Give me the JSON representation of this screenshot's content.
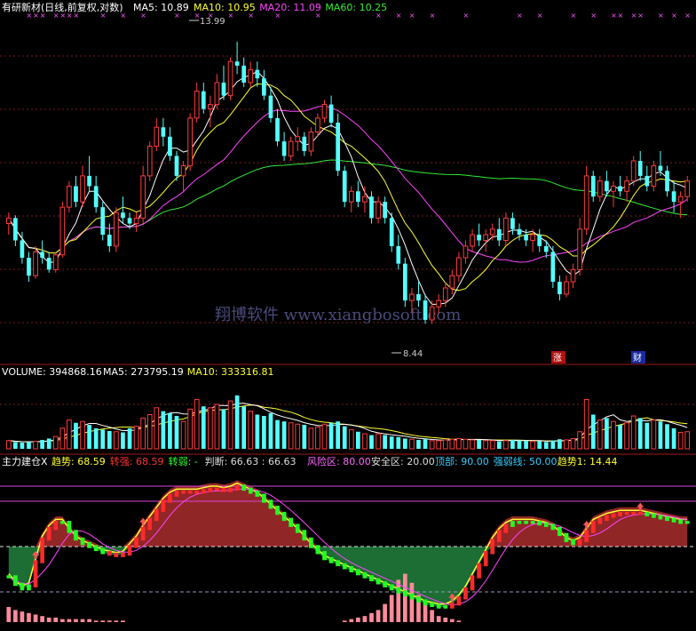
{
  "chart_data": [
    {
      "panel": "price",
      "type": "candlestick",
      "title": "有研新材(日线,前复权,对数)",
      "log_scale": true,
      "ylim": [
        8.0,
        14.6
      ],
      "legend": [
        {
          "label": "MA5: 10.89",
          "color": "#ffffff"
        },
        {
          "label": "MA10: 10.95",
          "color": "#ffff33"
        },
        {
          "label": "MA20: 11.09",
          "color": "#ff44ff"
        },
        {
          "label": "MA60: 10.25",
          "color": "#33ee33"
        }
      ],
      "annotations": {
        "high": "13.99",
        "low": "8.44"
      },
      "event_markers": [
        "涨",
        "财"
      ],
      "watermark": "翔博软件 www.xiangbosoft.com",
      "candles": [
        [
          10.1,
          10.3,
          9.9,
          10.2
        ],
        [
          10.2,
          10.25,
          9.7,
          9.8
        ],
        [
          9.8,
          9.95,
          9.4,
          9.5
        ],
        [
          9.5,
          9.6,
          9.1,
          9.2
        ],
        [
          9.2,
          9.7,
          9.15,
          9.6
        ],
        [
          9.6,
          9.8,
          9.4,
          9.5
        ],
        [
          9.5,
          9.6,
          9.25,
          9.3
        ],
        [
          9.3,
          9.6,
          9.25,
          9.55
        ],
        [
          9.55,
          10.5,
          9.5,
          10.4
        ],
        [
          10.4,
          10.9,
          10.3,
          10.8
        ],
        [
          10.8,
          11.0,
          10.4,
          10.5
        ],
        [
          10.5,
          11.2,
          10.4,
          11.0
        ],
        [
          11.0,
          11.4,
          10.7,
          10.8
        ],
        [
          10.8,
          11.0,
          10.3,
          10.4
        ],
        [
          10.4,
          10.5,
          9.8,
          9.9
        ],
        [
          9.9,
          10.1,
          9.6,
          9.7
        ],
        [
          9.7,
          10.4,
          9.6,
          10.3
        ],
        [
          10.3,
          10.6,
          10.1,
          10.2
        ],
        [
          10.2,
          10.3,
          10.0,
          10.1
        ],
        [
          10.1,
          10.3,
          9.95,
          10.2
        ],
        [
          10.2,
          11.2,
          10.1,
          11.0
        ],
        [
          11.0,
          11.7,
          10.9,
          11.6
        ],
        [
          11.6,
          12.2,
          11.5,
          12.0
        ],
        [
          12.0,
          12.2,
          11.6,
          11.8
        ],
        [
          11.8,
          12.0,
          11.3,
          11.4
        ],
        [
          11.4,
          11.5,
          10.9,
          11.0
        ],
        [
          11.0,
          11.3,
          10.7,
          11.2
        ],
        [
          11.2,
          12.3,
          11.1,
          12.2
        ],
        [
          12.2,
          13.0,
          12.1,
          12.8
        ],
        [
          12.8,
          13.0,
          12.3,
          12.4
        ],
        [
          12.4,
          12.7,
          12.0,
          12.5
        ],
        [
          12.5,
          13.2,
          12.4,
          13.0
        ],
        [
          13.0,
          13.4,
          12.6,
          12.7
        ],
        [
          12.7,
          13.6,
          12.6,
          13.5
        ],
        [
          13.5,
          13.99,
          13.2,
          13.4
        ],
        [
          13.4,
          13.6,
          12.9,
          13.0
        ],
        [
          13.0,
          13.5,
          12.9,
          13.3
        ],
        [
          13.3,
          13.5,
          12.9,
          13.1
        ],
        [
          13.1,
          13.3,
          12.6,
          12.7
        ],
        [
          12.7,
          12.9,
          12.1,
          12.2
        ],
        [
          12.2,
          12.4,
          11.6,
          11.7
        ],
        [
          11.7,
          11.9,
          11.3,
          11.4
        ],
        [
          11.4,
          11.8,
          11.3,
          11.7
        ],
        [
          11.7,
          12.0,
          11.5,
          11.8
        ],
        [
          11.8,
          11.9,
          11.4,
          11.5
        ],
        [
          11.5,
          12.0,
          11.4,
          11.9
        ],
        [
          11.9,
          12.3,
          11.8,
          12.2
        ],
        [
          12.2,
          12.6,
          12.1,
          12.5
        ],
        [
          12.5,
          12.7,
          12.0,
          12.1
        ],
        [
          12.1,
          12.3,
          11.0,
          11.1
        ],
        [
          11.1,
          11.2,
          10.4,
          10.5
        ],
        [
          10.5,
          10.8,
          10.3,
          10.7
        ],
        [
          10.7,
          10.9,
          10.4,
          10.5
        ],
        [
          10.5,
          10.8,
          10.3,
          10.6
        ],
        [
          10.6,
          10.7,
          10.1,
          10.2
        ],
        [
          10.2,
          10.6,
          10.1,
          10.5
        ],
        [
          10.5,
          10.6,
          10.1,
          10.2
        ],
        [
          10.2,
          10.3,
          9.6,
          9.7
        ],
        [
          9.7,
          9.9,
          9.3,
          9.4
        ],
        [
          9.4,
          9.5,
          8.7,
          8.8
        ],
        [
          8.8,
          9.0,
          8.6,
          8.9
        ],
        [
          8.9,
          9.1,
          8.7,
          8.8
        ],
        [
          8.8,
          8.9,
          8.44,
          8.5
        ],
        [
          8.5,
          8.8,
          8.44,
          8.7
        ],
        [
          8.7,
          8.9,
          8.6,
          8.8
        ],
        [
          8.8,
          9.1,
          8.7,
          9.0
        ],
        [
          9.0,
          9.3,
          8.9,
          9.2
        ],
        [
          9.2,
          9.6,
          9.1,
          9.5
        ],
        [
          9.5,
          9.8,
          9.4,
          9.7
        ],
        [
          9.7,
          10.0,
          9.6,
          9.9
        ],
        [
          9.9,
          10.1,
          9.7,
          9.8
        ],
        [
          9.8,
          10.0,
          9.6,
          9.9
        ],
        [
          9.9,
          10.1,
          9.8,
          10.0
        ],
        [
          10.0,
          10.2,
          9.7,
          9.8
        ],
        [
          9.8,
          10.3,
          9.7,
          10.2
        ],
        [
          10.2,
          10.3,
          9.9,
          10.0
        ],
        [
          10.0,
          10.1,
          9.8,
          9.9
        ],
        [
          9.9,
          10.0,
          9.7,
          9.8
        ],
        [
          9.8,
          10.0,
          9.6,
          9.9
        ],
        [
          9.9,
          10.0,
          9.6,
          9.7
        ],
        [
          9.7,
          9.8,
          9.5,
          9.6
        ],
        [
          9.6,
          9.7,
          9.0,
          9.1
        ],
        [
          9.1,
          9.2,
          8.8,
          8.9
        ],
        [
          8.9,
          9.2,
          8.85,
          9.1
        ],
        [
          9.1,
          9.4,
          9.0,
          9.3
        ],
        [
          9.3,
          10.2,
          9.2,
          10.0
        ],
        [
          10.0,
          11.2,
          9.9,
          11.0
        ],
        [
          11.0,
          11.1,
          10.5,
          10.6
        ],
        [
          10.6,
          11.0,
          10.5,
          10.9
        ],
        [
          10.9,
          11.1,
          10.6,
          10.7
        ],
        [
          10.7,
          10.9,
          10.4,
          10.8
        ],
        [
          10.8,
          11.0,
          10.6,
          10.7
        ],
        [
          10.7,
          11.0,
          10.5,
          10.9
        ],
        [
          10.9,
          11.4,
          10.8,
          11.3
        ],
        [
          11.3,
          11.5,
          10.9,
          11.0
        ],
        [
          11.0,
          11.2,
          10.7,
          10.8
        ],
        [
          10.8,
          11.3,
          10.7,
          11.2
        ],
        [
          11.2,
          11.5,
          11.0,
          11.1
        ],
        [
          11.1,
          11.2,
          10.6,
          10.7
        ],
        [
          10.7,
          10.9,
          10.3,
          10.5
        ],
        [
          10.5,
          10.7,
          10.2,
          10.6
        ],
        [
          10.6,
          11.0,
          10.5,
          10.9
        ]
      ]
    },
    {
      "panel": "volume",
      "type": "bar",
      "label": "VOLUME: 394868.16",
      "legend": [
        {
          "label": "MA5: 273795.19",
          "color": "#ffffff"
        },
        {
          "label": "MA10: 333316.81",
          "color": "#ffff33"
        }
      ],
      "values": [
        0.12,
        0.1,
        0.09,
        0.1,
        0.11,
        0.13,
        0.15,
        0.18,
        0.3,
        0.42,
        0.38,
        0.4,
        0.35,
        0.3,
        0.28,
        0.26,
        0.25,
        0.24,
        0.3,
        0.33,
        0.45,
        0.5,
        0.6,
        0.55,
        0.52,
        0.48,
        0.4,
        0.58,
        0.72,
        0.62,
        0.6,
        0.65,
        0.58,
        0.7,
        0.78,
        0.62,
        0.55,
        0.5,
        0.48,
        0.52,
        0.42,
        0.4,
        0.38,
        0.36,
        0.35,
        0.3,
        0.32,
        0.36,
        0.38,
        0.4,
        0.33,
        0.28,
        0.25,
        0.22,
        0.2,
        0.22,
        0.2,
        0.18,
        0.17,
        0.15,
        0.14,
        0.13,
        0.14,
        0.12,
        0.12,
        0.13,
        0.14,
        0.15,
        0.14,
        0.13,
        0.13,
        0.12,
        0.12,
        0.11,
        0.12,
        0.13,
        0.12,
        0.12,
        0.11,
        0.11,
        0.1,
        0.12,
        0.14,
        0.13,
        0.15,
        0.25,
        0.72,
        0.5,
        0.42,
        0.45,
        0.4,
        0.35,
        0.38,
        0.48,
        0.45,
        0.38,
        0.42,
        0.4,
        0.36,
        0.3,
        0.24,
        0.25
      ]
    },
    {
      "panel": "indicator",
      "type": "oscillator",
      "title": "主力建仓X",
      "legend": [
        {
          "label": "趋势: 68.59",
          "color": "#ffff33"
        },
        {
          "label": "转强: 68.59",
          "color": "#ff3333"
        },
        {
          "label": "转弱: -",
          "color": "#33ff33"
        },
        {
          "label": "判断: 66.63 : 66.63",
          "color": "#dddddd"
        },
        {
          "label": "风险区: 80.00",
          "color": "#ff66ff"
        },
        {
          "label": "安全区: 20.00",
          "color": "#dddddd"
        },
        {
          "label": "顶部: 90.00",
          "color": "#33ccff"
        },
        {
          "label": "强弱线: 50.00",
          "color": "#33ccff"
        },
        {
          "label": "趋势1: 14.44",
          "color": "#ffff33"
        }
      ],
      "levels": {
        "top": 90,
        "risk": 80,
        "strength": 50,
        "safe": 20
      },
      "ylim": [
        0,
        100
      ],
      "trend": [
        30,
        25,
        22,
        24,
        40,
        55,
        62,
        66,
        66,
        60,
        55,
        52,
        50,
        48,
        46,
        45,
        44,
        45,
        50,
        55,
        62,
        68,
        74,
        80,
        84,
        86,
        86,
        86,
        86,
        87,
        88,
        88,
        87,
        88,
        90,
        88,
        86,
        84,
        80,
        76,
        72,
        68,
        64,
        60,
        55,
        50,
        46,
        42,
        40,
        38,
        36,
        34,
        32,
        30,
        28,
        26,
        24,
        22,
        20,
        18,
        16,
        14,
        12,
        11,
        10,
        10,
        12,
        16,
        22,
        30,
        38,
        46,
        54,
        60,
        64,
        66,
        66,
        66,
        66,
        65,
        64,
        62,
        58,
        54,
        52,
        54,
        60,
        66,
        68,
        70,
        71,
        72,
        72,
        72,
        72,
        71,
        70,
        69,
        68,
        67,
        66,
        66
      ],
      "trend_color": [
        0,
        0,
        0,
        0,
        1,
        1,
        1,
        1,
        0,
        0,
        0,
        0,
        0,
        0,
        0,
        1,
        1,
        1,
        1,
        1,
        1,
        1,
        1,
        1,
        1,
        1,
        1,
        1,
        1,
        1,
        1,
        1,
        1,
        1,
        1,
        0,
        0,
        0,
        0,
        0,
        0,
        0,
        0,
        0,
        0,
        0,
        0,
        0,
        0,
        0,
        0,
        0,
        0,
        0,
        0,
        0,
        0,
        0,
        0,
        0,
        0,
        0,
        0,
        0,
        0,
        0,
        1,
        1,
        1,
        1,
        1,
        1,
        1,
        1,
        1,
        0,
        0,
        0,
        0,
        0,
        0,
        0,
        0,
        0,
        0,
        1,
        1,
        1,
        1,
        1,
        1,
        1,
        1,
        1,
        1,
        0,
        0,
        0,
        0,
        0,
        0,
        0
      ],
      "histogram": [
        10,
        8,
        7,
        6,
        5,
        4,
        3,
        3,
        2,
        2,
        2,
        2,
        2,
        1,
        1,
        1,
        1,
        1,
        0,
        0,
        0,
        0,
        0,
        0,
        0,
        0,
        0,
        0,
        0,
        0,
        0,
        0,
        0,
        0,
        0,
        0,
        0,
        0,
        0,
        0,
        0,
        0,
        0,
        0,
        0,
        0,
        0,
        0,
        0,
        0,
        1,
        2,
        3,
        4,
        6,
        8,
        12,
        18,
        28,
        32,
        26,
        18,
        12,
        8,
        4,
        3,
        2,
        1,
        0,
        0,
        0,
        0,
        0,
        0,
        0,
        0,
        0,
        0,
        0,
        0,
        0,
        0,
        0,
        0,
        0,
        0,
        0,
        0,
        0,
        0,
        0,
        0,
        0,
        0,
        0,
        0,
        0,
        0,
        0,
        0,
        0,
        0
      ]
    }
  ]
}
